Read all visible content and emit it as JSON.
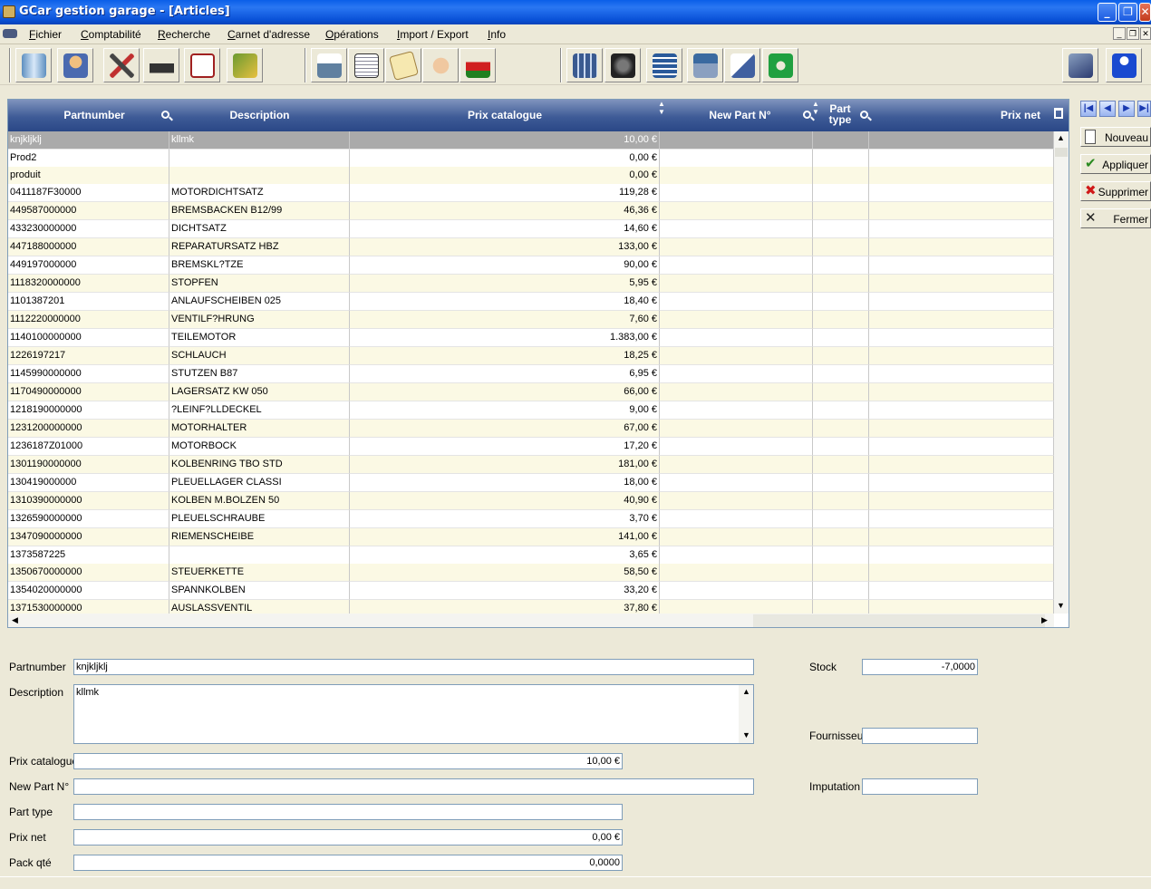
{
  "window": {
    "title": "GCar gestion garage - [Articles]"
  },
  "menu": [
    "Fichier",
    "Comptabilité",
    "Recherche",
    "Carnet d'adresse",
    "Opérations",
    "Import / Export",
    "Info"
  ],
  "toolbar_icons": [
    "gate-icon",
    "user-icon",
    "tools-icon",
    "mechanic-icon",
    "calendar-icon",
    "folders-icon",
    "printer-icon",
    "notepad-icon",
    "scroll-icon",
    "hand-icon",
    "car-icon",
    "calculator-icon",
    "motor-icon",
    "film-icon",
    "keyboard-icon",
    "edit-icon",
    "recycle-icon",
    "help-book-icon",
    "info-icon"
  ],
  "grid": {
    "columns": [
      "Partnumber",
      "Description",
      "Prix catalogue",
      "New Part N°",
      "Part type",
      "Prix net"
    ],
    "rows": [
      [
        "knjkljklj",
        "kllmk",
        "10,00 €"
      ],
      [
        "Prod2",
        "",
        "0,00 €"
      ],
      [
        "produit",
        "",
        "0,00 €"
      ],
      [
        "0411187F30000",
        "MOTORDICHTSATZ",
        "119,28 €"
      ],
      [
        "449587000000",
        "BREMSBACKEN B12/99",
        "46,36 €"
      ],
      [
        "433230000000",
        "DICHTSATZ",
        "14,60 €"
      ],
      [
        "447188000000",
        "REPARATURSATZ HBZ",
        "133,00 €"
      ],
      [
        "449197000000",
        "BREMSKL?TZE",
        "90,00 €"
      ],
      [
        "1118320000000",
        "STOPFEN",
        "5,95 €"
      ],
      [
        "1101387201",
        "ANLAUFSCHEIBEN 025",
        "18,40 €"
      ],
      [
        "1112220000000",
        "VENTILF?HRUNG",
        "7,60 €"
      ],
      [
        "1140100000000",
        "TEILEMOTOR",
        "1.383,00 €"
      ],
      [
        "1226197217",
        "SCHLAUCH",
        "18,25 €"
      ],
      [
        "1145990000000",
        "STUTZEN       B87",
        "6,95 €"
      ],
      [
        "1170490000000",
        "LAGERSATZ KW   050",
        "66,00 €"
      ],
      [
        "1218190000000",
        "?LEINF?LLDECKEL",
        "9,00 €"
      ],
      [
        "1231200000000",
        "MOTORHALTER",
        "67,00 €"
      ],
      [
        "1236187Z01000",
        "MOTORBOCK",
        "17,20 €"
      ],
      [
        "1301190000000",
        "KOLBENRING TBO STD",
        "181,00 €"
      ],
      [
        "130419000000",
        "PLEUELLAGER CLASSI",
        "18,00 €"
      ],
      [
        "1310390000000",
        "KOLBEN M.BOLZEN 50",
        "40,90 €"
      ],
      [
        "1326590000000",
        "PLEUELSCHRAUBE",
        "3,70 €"
      ],
      [
        "1347090000000",
        "RIEMENSCHEIBE",
        "141,00 €"
      ],
      [
        "1373587225",
        "",
        "3,65 €"
      ],
      [
        "1350670000000",
        "STEUERKETTE",
        "58,50 €"
      ],
      [
        "1354020000000",
        "SPANNKOLBEN",
        "33,20 €"
      ],
      [
        "1371530000000",
        "AUSLASSVENTIL",
        "37,80 €"
      ]
    ]
  },
  "side_buttons": {
    "nouveau": "Nouveau",
    "appliquer": "Appliquer",
    "supprimer": "Supprimer",
    "fermer": "Fermer"
  },
  "form": {
    "partnumber_label": "Partnumber",
    "partnumber": "knjkljklj",
    "description_label": "Description",
    "description": "kllmk",
    "prix_catalogue_label": "Prix catalogue",
    "prix_catalogue": "10,00 €",
    "new_part_label": "New Part N°",
    "new_part": "",
    "part_type_label": "Part type",
    "part_type": "",
    "prix_net_label": "Prix net",
    "prix_net": "0,00 €",
    "pack_qte_label": "Pack qté",
    "pack_qte": "0,0000",
    "stock_label": "Stock",
    "stock": "-7,0000",
    "fournisseur_label": "Fournisseur",
    "fournisseur": "",
    "imputation_label": "Imputation",
    "imputation": ""
  }
}
